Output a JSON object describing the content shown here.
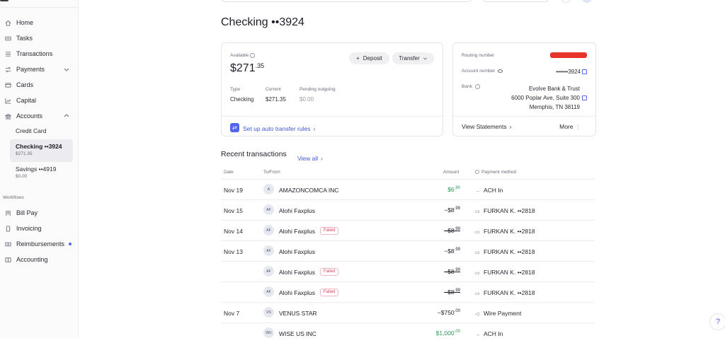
{
  "sidebar": {
    "items": [
      {
        "label": "Home",
        "icon": "home-icon"
      },
      {
        "label": "Tasks",
        "icon": "tasks-icon"
      },
      {
        "label": "Transactions",
        "icon": "list-icon"
      },
      {
        "label": "Payments",
        "icon": "arrows-icon"
      },
      {
        "label": "Cards",
        "icon": "card-icon"
      },
      {
        "label": "Capital",
        "icon": "chart-icon"
      },
      {
        "label": "Accounts",
        "icon": "bank-icon"
      }
    ],
    "accounts": [
      {
        "label": "Credit Card",
        "amount": ""
      },
      {
        "label": "Checking ••3924",
        "amount": "$271.35"
      },
      {
        "label": "Savings ••4919",
        "amount": "$0.00"
      }
    ],
    "workflows_label": "Workflows",
    "workflows": [
      {
        "label": "Bill Pay",
        "icon": "bill-icon"
      },
      {
        "label": "Invoicing",
        "icon": "invoice-icon"
      },
      {
        "label": "Reimbursements",
        "icon": "receipt-icon"
      },
      {
        "label": "Accounting",
        "icon": "ledger-icon"
      }
    ]
  },
  "page": {
    "title": "Checking ••3924"
  },
  "balance_card": {
    "available_label": "Available",
    "amount_main": "$271",
    "amount_cents": ".35",
    "deposit_label": "Deposit",
    "transfer_label": "Transfer",
    "type_label": "Type",
    "type_value": "Checking",
    "current_label": "Current",
    "current_value": "$271.35",
    "pending_label": "Pending outgoing",
    "pending_value": "$0.00",
    "auto_transfer_label": "Set up auto transfer rules"
  },
  "details_card": {
    "routing_label": "Routing number",
    "account_label": "Account number",
    "account_value": "••••••3924",
    "bank_label": "Bank",
    "bank_line1": "Evolve Bank & Trust",
    "bank_line2": "6000 Poplar Ave, Suite 300",
    "bank_line3": "Memphis, TN 38119",
    "statements_label": "View Statements",
    "more_label": "More"
  },
  "transactions": {
    "title": "Recent transactions",
    "view_all": "View all",
    "headers": {
      "date": "Date",
      "to_from": "To/From",
      "amount": "Amount",
      "method": "Payment method"
    },
    "rows": [
      {
        "date": "Nov 19",
        "initials": "A",
        "name": "AMAZONCOMCA INC",
        "failed": "",
        "amount": "$6",
        "cents": ".90",
        "method": "ACH In",
        "micon": "→"
      },
      {
        "date": "Nov 15",
        "initials": "AF",
        "name": "Alohi Faxplus",
        "failed": "",
        "amount": "−$8",
        "cents": ".99",
        "method": "FURKAN K. ••2818",
        "micon": "▭"
      },
      {
        "date": "Nov 14",
        "initials": "AF",
        "name": "Alohi Faxplus",
        "failed": "Failed",
        "amount": "−$8",
        "cents": ".99",
        "method": "FURKAN K. ••2818",
        "micon": "▭"
      },
      {
        "date": "Nov 13",
        "initials": "AF",
        "name": "Alohi Faxplus",
        "failed": "",
        "amount": "−$8",
        "cents": ".99",
        "method": "FURKAN K. ••2818",
        "micon": "▭"
      },
      {
        "date": "",
        "initials": "AF",
        "name": "Alohi Faxplus",
        "failed": "Failed",
        "amount": "−$8",
        "cents": ".99",
        "method": "FURKAN K. ••2818",
        "micon": "▭"
      },
      {
        "date": "",
        "initials": "AF",
        "name": "Alohi Faxplus",
        "failed": "Failed",
        "amount": "−$8",
        "cents": ".99",
        "method": "FURKAN K. ••2818",
        "micon": "▭"
      },
      {
        "date": "Nov 7",
        "initials": "VS",
        "name": "VENUS STAR",
        "failed": "",
        "amount": "−$750",
        "cents": ".00",
        "method": "Wire Payment",
        "micon": "◁"
      },
      {
        "date": "",
        "initials": "WU",
        "name": "WISE US INC",
        "failed": "",
        "amount": "$1,000",
        "cents": ".00",
        "method": "ACH In",
        "micon": "→"
      }
    ]
  },
  "help_label": "?",
  "colors": {
    "accent": "#5266eb",
    "positive": "#2a9a5a",
    "failed": "#d2455a"
  }
}
